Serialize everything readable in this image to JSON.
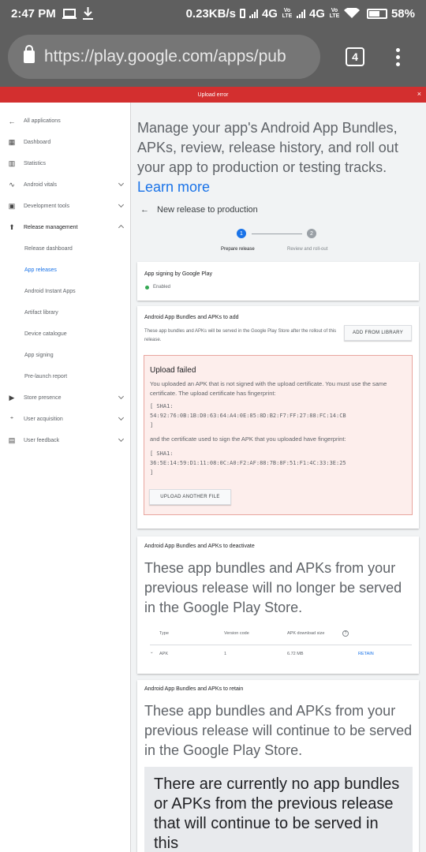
{
  "status_bar": {
    "time": "2:47 PM",
    "speed": "0.23KB/s",
    "net1": "4G",
    "net2": "4G",
    "volte": "Vo LTE",
    "battery": "58%"
  },
  "browser": {
    "url": "https://play.google.com/apps/pub",
    "tab_count": "4"
  },
  "banner": {
    "text": "Upload error",
    "close": "×"
  },
  "sidebar": {
    "items": [
      {
        "label": "All applications",
        "icon": "arrow-left-icon"
      },
      {
        "label": "Dashboard",
        "icon": "dashboard-icon"
      },
      {
        "label": "Statistics",
        "icon": "statistics-icon"
      },
      {
        "label": "Android vitals",
        "icon": "vitals-icon"
      },
      {
        "label": "Development tools",
        "icon": "dev-tools-icon"
      },
      {
        "label": "Release management",
        "icon": "rocket-icon"
      },
      {
        "label": "Release dashboard"
      },
      {
        "label": "App releases"
      },
      {
        "label": "Android Instant Apps"
      },
      {
        "label": "Artifact library"
      },
      {
        "label": "Device catalogue"
      },
      {
        "label": "App signing"
      },
      {
        "label": "Pre-launch report"
      },
      {
        "label": "Store presence",
        "icon": "store-icon"
      },
      {
        "label": "User acquisition",
        "icon": "user-add-icon"
      },
      {
        "label": "User feedback",
        "icon": "feedback-icon"
      }
    ]
  },
  "main": {
    "intro": "Manage your app's Android App Bundles, APKs, review, release history, and roll out your app to production or testing tracks.",
    "learn_more": "Learn more",
    "back_label": "New release to production",
    "steps": [
      {
        "num": "1",
        "label": "Prepare release"
      },
      {
        "num": "2",
        "label": "Review and roll-out"
      }
    ],
    "signing": {
      "title": "App signing by Google Play",
      "status": "Enabled"
    },
    "add": {
      "title": "Android App Bundles and APKs to add",
      "desc": "These app bundles and APKs will be served in the Google Play Store after the rollout of this release.",
      "button": "ADD FROM LIBRARY",
      "error": {
        "heading": "Upload failed",
        "text1": "You uploaded an APK that is not signed with the upload certificate. You must use the same certificate. The upload certificate has fingerprint:",
        "fp1_open": "[ SHA1:",
        "fp1": "54:92:76:0B:1B:D0:63:64:A4:0E:85:8D:B2:F7:FF:27:88:FC:14:CB",
        "fp1_close": "]",
        "text2": "and the certificate used to sign the APK that you uploaded have fingerprint:",
        "fp2_open": "[ SHA1:",
        "fp2": "36:5E:14:59:D1:11:08:0C:A0:F2:AF:88:7B:8F:51:F1:4C:33:3E:25",
        "fp2_close": "]",
        "button": "UPLOAD ANOTHER FILE"
      }
    },
    "deactivate": {
      "title": "Android App Bundles and APKs to deactivate",
      "text": "These app bundles and APKs from your previous release will no longer be served in the Google Play Store.",
      "columns": [
        "Type",
        "Version code",
        "APK download size"
      ],
      "row": {
        "type": "APK",
        "version": "1",
        "size": "6.72 MB",
        "action": "RETAIN"
      }
    },
    "retain": {
      "title": "Android App Bundles and APKs to retain",
      "text": "These app bundles and APKs from your previous release will continue to be served in the Google Play Store.",
      "empty": "There are currently no app bundles or APKs from the previous release that will continue to be served in this"
    }
  }
}
